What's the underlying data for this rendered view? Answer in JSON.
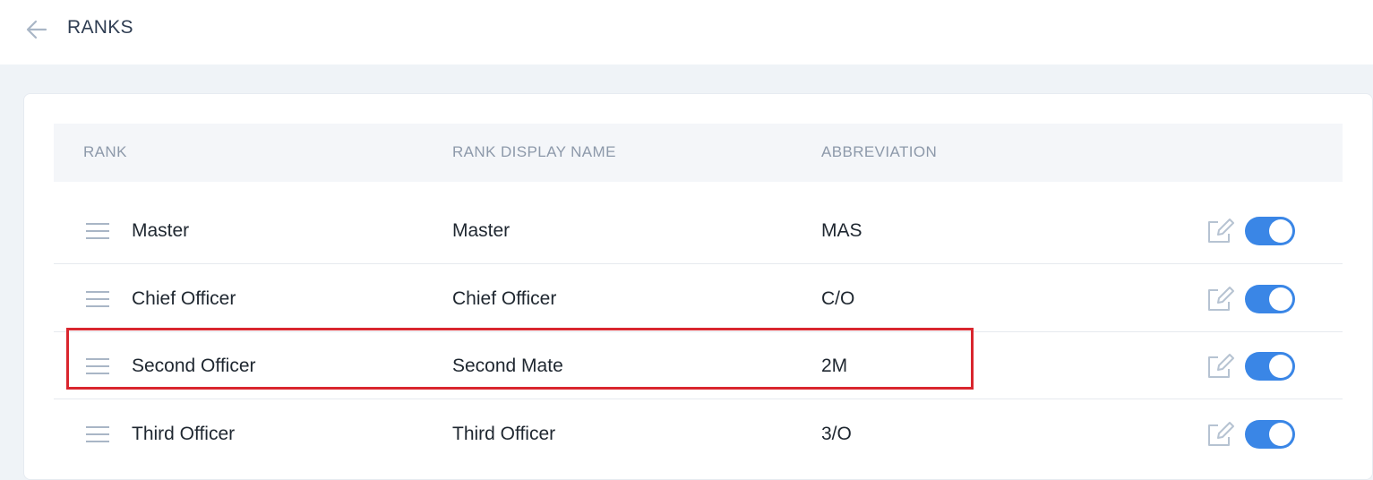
{
  "header": {
    "title": "RANKS",
    "back_icon": "arrow-left-icon"
  },
  "table": {
    "columns": [
      "RANK",
      "RANK DISPLAY NAME",
      "ABBREVIATION"
    ],
    "rows": [
      {
        "rank": "Master",
        "display_name": "Master",
        "abbreviation": "MAS",
        "active": true
      },
      {
        "rank": "Chief Officer",
        "display_name": "Chief Officer",
        "abbreviation": "C/O",
        "active": true
      },
      {
        "rank": "Second Officer",
        "display_name": "Second Mate",
        "abbreviation": "2M",
        "active": true
      },
      {
        "rank": "Third Officer",
        "display_name": "Third Officer",
        "abbreviation": "3/O",
        "active": true
      }
    ]
  },
  "colors": {
    "accent": "#3a86e6",
    "highlight": "#d9262e"
  }
}
